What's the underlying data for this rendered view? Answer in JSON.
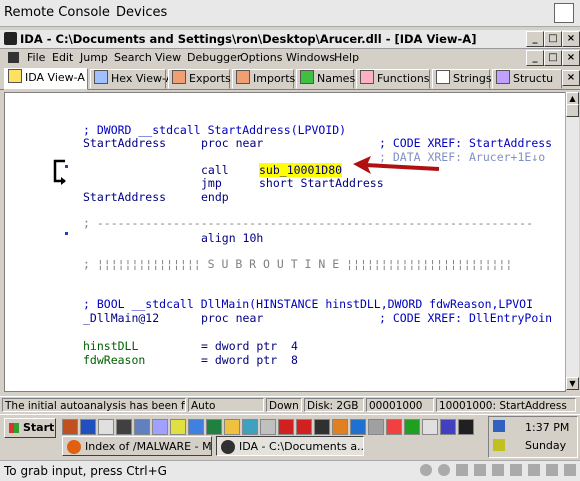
{
  "remote_console": {
    "menu": [
      "Remote Console",
      "Devices"
    ],
    "status_hint": "To grab input, press Ctrl+G"
  },
  "ida": {
    "title": "IDA - C:\\Documents and Settings\\ron\\Desktop\\Arucer.dll - [IDA View-A]",
    "menu": [
      "File",
      "Edit",
      "Jump",
      "Search",
      "View",
      "Debugger",
      "Options",
      "Windows",
      "Help"
    ],
    "tabs": [
      "IDA View-A",
      "Hex View-A",
      "Exports",
      "Imports",
      "Names",
      "Functions",
      "Strings",
      "Structu"
    ],
    "code": {
      "l1": "; DWORD __stdcall StartAddress(LPVOID)",
      "l2_label": "StartAddress",
      "l2_op": "proc near",
      "l2_xref": "; CODE XREF: StartAddress",
      "l3_xref": "; DATA XREF: Arucer+1E↓o",
      "l3_instr": "call",
      "l3_target": "sub_10001D80",
      "l4_instr": "jmp",
      "l4_arg": "short StartAddress",
      "l5_label": "StartAddress",
      "l5_op": "endp",
      "l6_sep": "; ---------------------------------------------------------------",
      "l7_instr": "align 10h",
      "l8_sub": "; ¦¦¦¦¦¦¦¦¦¦¦¦¦¦¦ S U B R O U T I N E ¦¦¦¦¦¦¦¦¦¦¦¦¦¦¦¦¦¦¦¦¦¦¦¦",
      "l9": "; BOOL __stdcall DllMain(HINSTANCE hinstDLL,DWORD fdwReason,LPVOI",
      "l10_label": "_DllMain@12",
      "l10_op": "proc near",
      "l10_xref": "; CODE XREF: DllEntryPoin",
      "l11_var": "hinstDLL",
      "l11_def": "= dword ptr  4",
      "l12_var": "fdwReason",
      "l12_def": "= dword ptr  8"
    },
    "status": [
      "The initial autoanalysis has been finished.",
      "Auto",
      "Down",
      "Disk: 2GB",
      "00001000",
      "10001000: StartAddress"
    ]
  },
  "taskbar": {
    "start": "Start",
    "tasks": [
      "Index of /MALWARE - M...",
      "IDA - C:\\Documents a..."
    ],
    "time": "1:37 PM",
    "day": "Sunday"
  }
}
